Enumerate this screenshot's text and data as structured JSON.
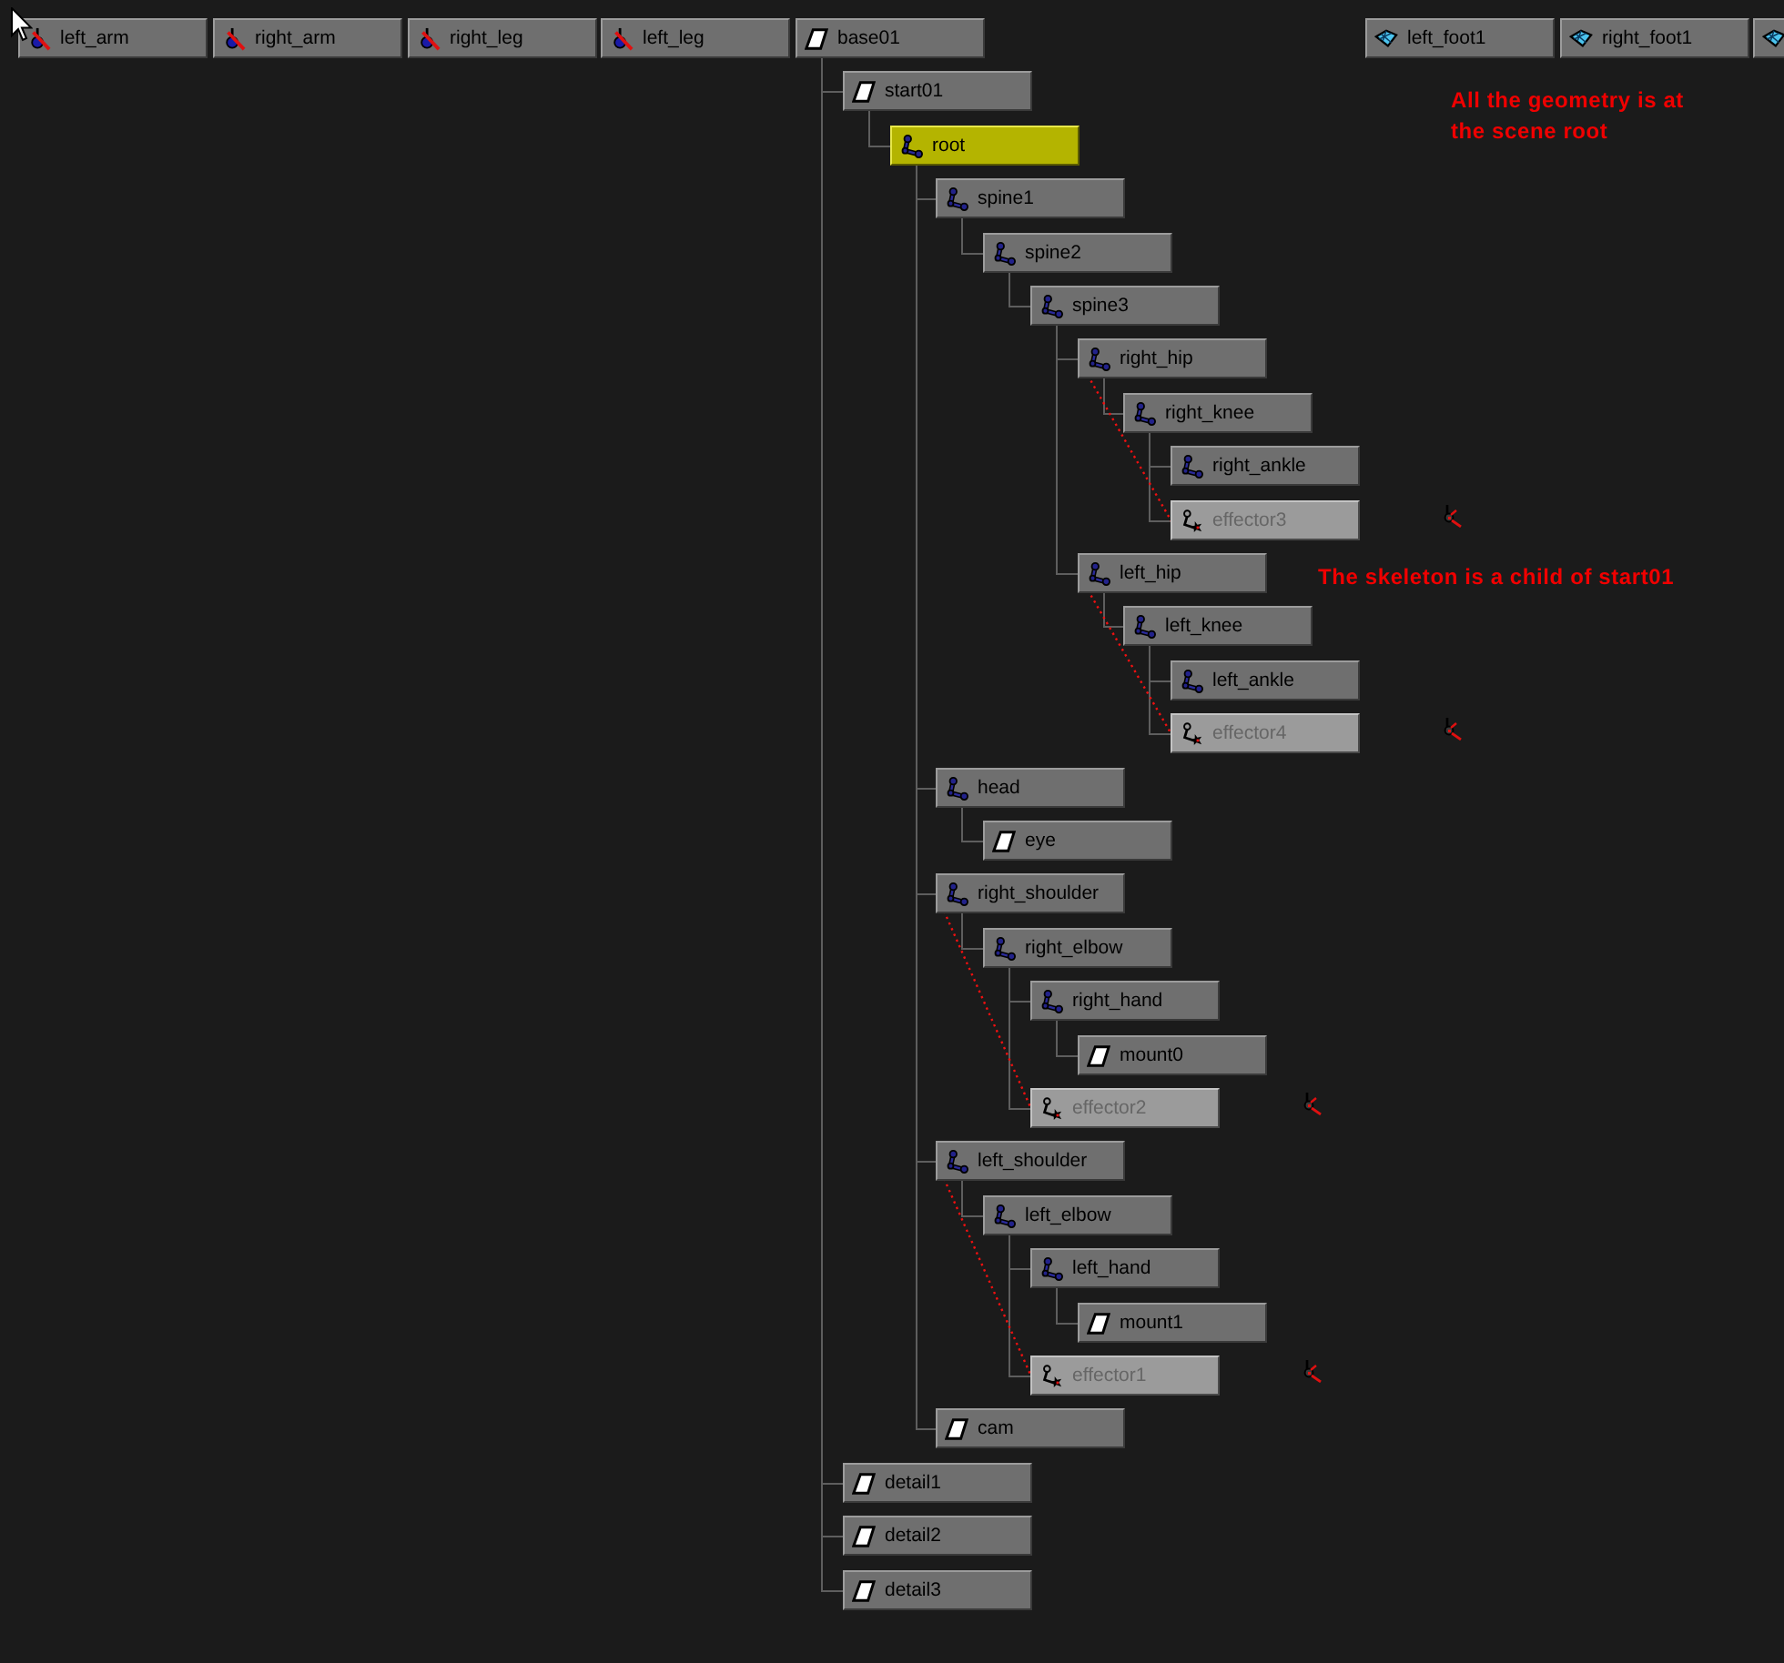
{
  "scene_root_nodes": [
    {
      "label": "left_arm",
      "kind": "skin",
      "selected": false
    },
    {
      "label": "right_arm",
      "kind": "skin",
      "selected": false
    },
    {
      "label": "right_leg",
      "kind": "skin",
      "selected": false
    },
    {
      "label": "left_leg",
      "kind": "skin",
      "selected": false
    },
    {
      "label": "base01",
      "kind": "transform",
      "selected": false,
      "children": [
        {
          "label": "start01",
          "kind": "transform",
          "selected": false,
          "children": [
            {
              "label": "root",
              "kind": "joint",
              "selected": true,
              "children": [
                {
                  "label": "spine1",
                  "kind": "joint",
                  "selected": false,
                  "children": [
                    {
                      "label": "spine2",
                      "kind": "joint",
                      "selected": false,
                      "children": [
                        {
                          "label": "spine3",
                          "kind": "joint",
                          "selected": false,
                          "children": [
                            {
                              "label": "right_hip",
                              "kind": "joint",
                              "selected": false,
                              "children": [
                                {
                                  "label": "right_knee",
                                  "kind": "joint",
                                  "selected": false,
                                  "children": [
                                    {
                                      "label": "right_ankle",
                                      "kind": "joint",
                                      "selected": false
                                    },
                                    {
                                      "label": "effector3",
                                      "kind": "effector",
                                      "selected": false
                                    }
                                  ]
                                }
                              ]
                            },
                            {
                              "label": "left_hip",
                              "kind": "joint",
                              "selected": false,
                              "children": [
                                {
                                  "label": "left_knee",
                                  "kind": "joint",
                                  "selected": false,
                                  "children": [
                                    {
                                      "label": "left_ankle",
                                      "kind": "joint",
                                      "selected": false
                                    },
                                    {
                                      "label": "effector4",
                                      "kind": "effector",
                                      "selected": false
                                    }
                                  ]
                                }
                              ]
                            }
                          ]
                        }
                      ]
                    }
                  ]
                },
                {
                  "label": "head",
                  "kind": "joint",
                  "selected": false,
                  "children": [
                    {
                      "label": "eye",
                      "kind": "transform",
                      "selected": false
                    }
                  ]
                },
                {
                  "label": "right_shoulder",
                  "kind": "joint",
                  "selected": false,
                  "children": [
                    {
                      "label": "right_elbow",
                      "kind": "joint",
                      "selected": false,
                      "children": [
                        {
                          "label": "right_hand",
                          "kind": "joint",
                          "selected": false,
                          "children": [
                            {
                              "label": "mount0",
                              "kind": "transform",
                              "selected": false
                            }
                          ]
                        },
                        {
                          "label": "effector2",
                          "kind": "effector",
                          "selected": false
                        }
                      ]
                    }
                  ]
                },
                {
                  "label": "left_shoulder",
                  "kind": "joint",
                  "selected": false,
                  "children": [
                    {
                      "label": "left_elbow",
                      "kind": "joint",
                      "selected": false,
                      "children": [
                        {
                          "label": "left_hand",
                          "kind": "joint",
                          "selected": false,
                          "children": [
                            {
                              "label": "mount1",
                              "kind": "transform",
                              "selected": false
                            }
                          ]
                        },
                        {
                          "label": "effector1",
                          "kind": "effector",
                          "selected": false
                        }
                      ]
                    }
                  ]
                },
                {
                  "label": "cam",
                  "kind": "transform",
                  "selected": false
                }
              ]
            }
          ]
        },
        {
          "label": "detail1",
          "kind": "transform",
          "selected": false
        },
        {
          "label": "detail2",
          "kind": "transform",
          "selected": false
        },
        {
          "label": "detail3",
          "kind": "transform",
          "selected": false
        }
      ]
    },
    {
      "label": "left_foot1",
      "kind": "mesh",
      "selected": false
    },
    {
      "label": "right_foot1",
      "kind": "mesh",
      "selected": false
    },
    {
      "kind": "mesh",
      "selected": false
    }
  ],
  "annotations": [
    {
      "text": "All the geometry is at the scene root"
    },
    {
      "text": "The skeleton is a child of start01"
    }
  ]
}
